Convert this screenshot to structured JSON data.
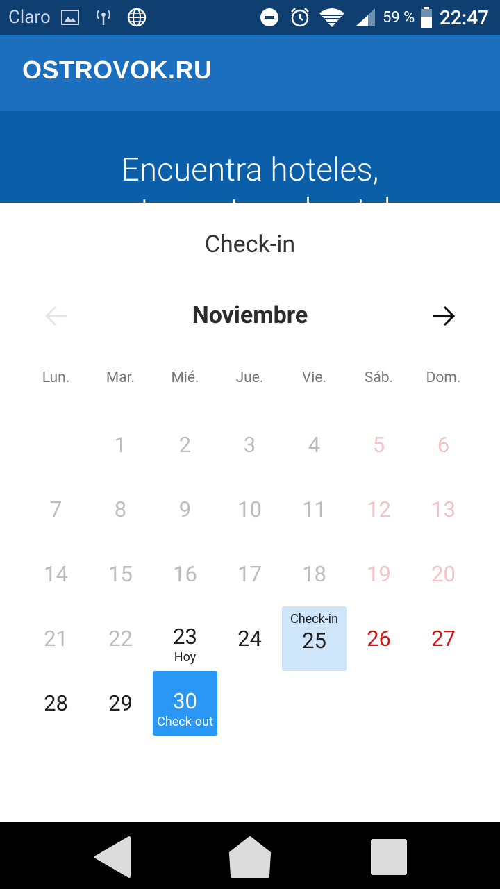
{
  "status_bar": {
    "carrier": "Claro",
    "battery": "59 %",
    "time": "22:47",
    "icons": [
      "image-icon",
      "hotspot-icon",
      "globe-icon",
      "do-not-disturb-icon",
      "alarm-icon",
      "wifi-icon",
      "signal-icon",
      "battery-icon"
    ]
  },
  "header": {
    "logo": "OSTROVOK.RU"
  },
  "hero": {
    "title": "Encuentra hoteles,",
    "subtitle": "apartamentos y hostales"
  },
  "calendar": {
    "title": "Check-in",
    "month": "Noviembre",
    "weekdays": [
      "Lun.",
      "Mar.",
      "Mié.",
      "Jue.",
      "Vie.",
      "Sáb.",
      "Dom."
    ],
    "weeks": [
      [
        null,
        "1",
        "2",
        "3",
        "4",
        "5",
        "6"
      ],
      [
        "7",
        "8",
        "9",
        "10",
        "11",
        "12",
        "13"
      ],
      [
        "14",
        "15",
        "16",
        "17",
        "18",
        "19",
        "20"
      ],
      [
        "21",
        "22",
        "23",
        "24",
        "25",
        "26",
        "27"
      ],
      [
        "28",
        "29",
        "30",
        null,
        null,
        null,
        null
      ]
    ],
    "today_label": "Hoy",
    "checkin_label": "Check-in",
    "checkout_label": "Check-out",
    "colors": {
      "checkin_bg": "#cfe5fa",
      "checkout_bg": "#2b97f4",
      "weekend": "#d01818"
    }
  }
}
